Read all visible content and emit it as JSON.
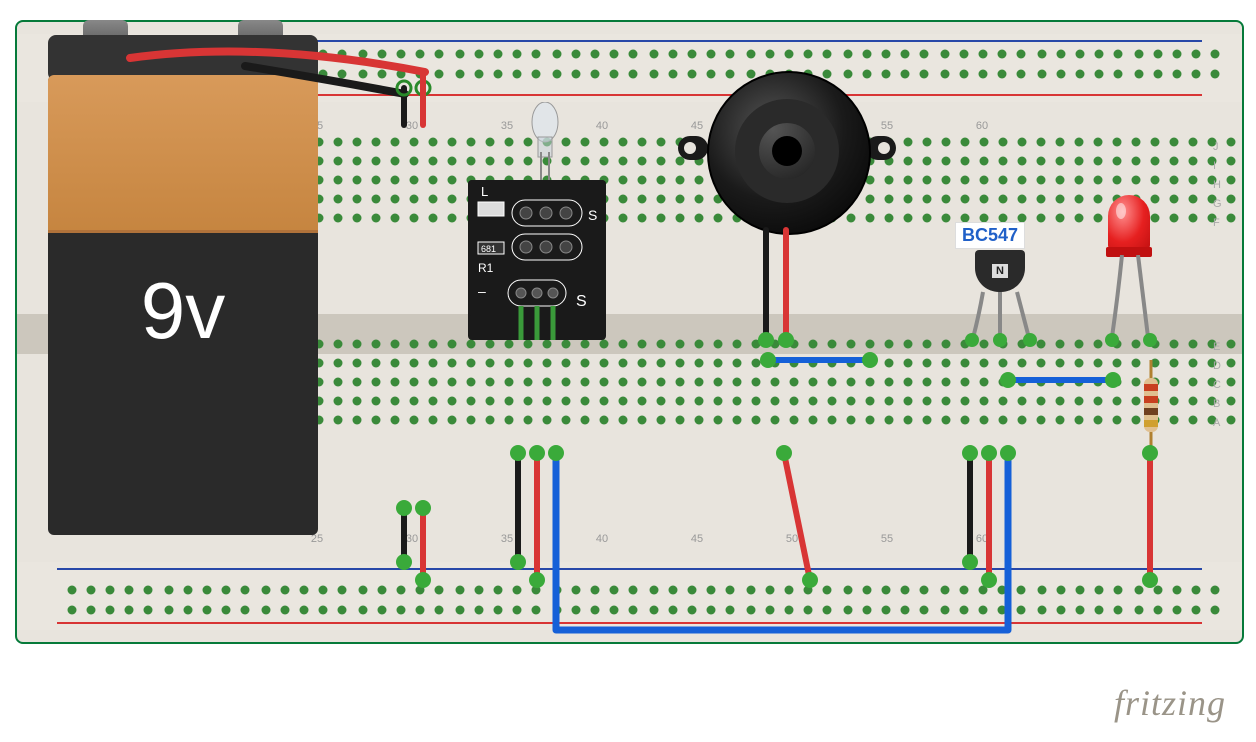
{
  "battery": {
    "label": "9v"
  },
  "sensor": {
    "pin_l": "L",
    "pin_s1": "S",
    "pin_s2": "S",
    "res": "681",
    "ref": "R1",
    "neg": "–"
  },
  "transistor": {
    "label": "BC547",
    "mark": "N"
  },
  "watermark": "fritzing",
  "columns": {
    "c25": "25",
    "c30": "30",
    "c35": "35",
    "c40": "40",
    "c45": "45",
    "c50": "50",
    "c55": "55",
    "c60": "60"
  },
  "components": {
    "battery": "9V Battery",
    "sensor": "IR Flame Sensor Module",
    "buzzer": "Piezo Buzzer",
    "transistor": "BC547 NPN",
    "led": "Red LED",
    "resistor": "Resistor"
  }
}
